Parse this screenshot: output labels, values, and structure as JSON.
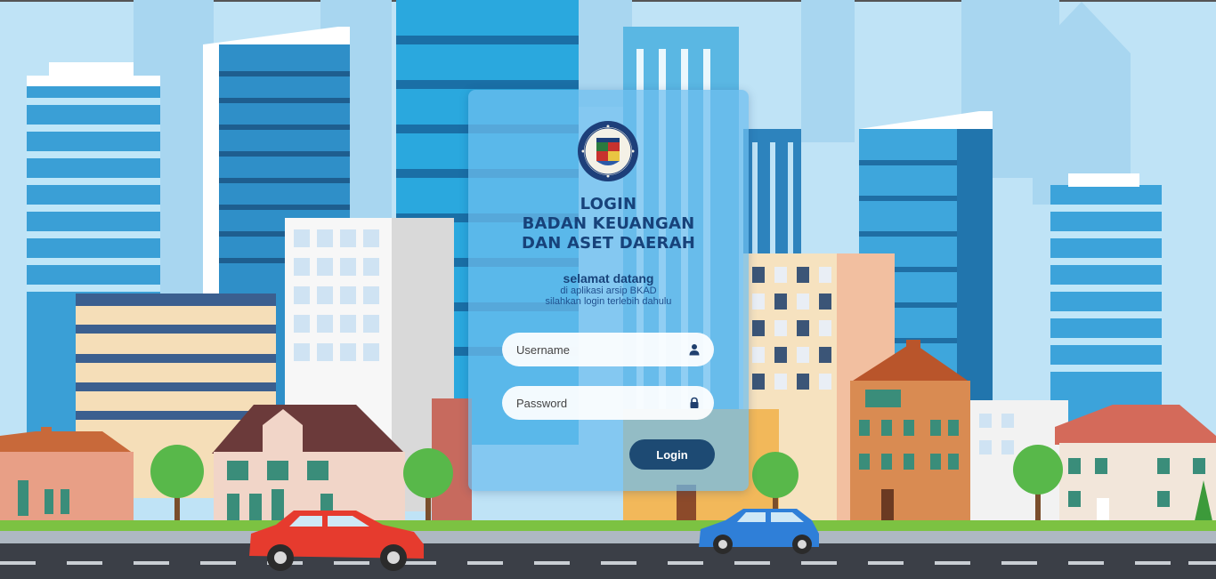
{
  "login_card": {
    "title_lines": [
      "LOGIN",
      "BADAN KEUANGAN",
      "DAN ASET DAERAH"
    ],
    "welcome_heading": "selamat datang",
    "welcome_line1": "di aplikasi arsip BKAD",
    "welcome_line2": "silahkan login terlebih dahulu",
    "username_placeholder": "Username",
    "username_value": "",
    "username_icon": "user-icon",
    "password_placeholder": "Password",
    "password_value": "",
    "password_icon": "lock-icon",
    "login_label": "Login"
  },
  "logo": {
    "icon": "city-government-emblem"
  },
  "colors": {
    "title_text": "#17427a",
    "card_background": "#6ebeee",
    "button": "#1d4a73",
    "sky": "#bfe3f6",
    "road": "#3b3f47"
  }
}
